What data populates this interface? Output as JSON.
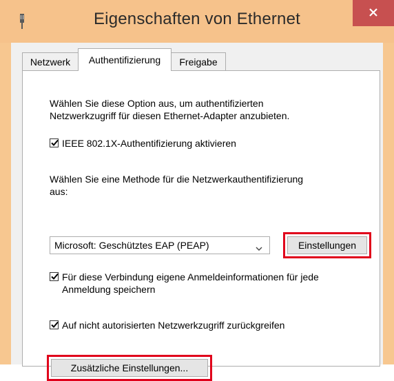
{
  "window": {
    "title": "Eigenschaften von Ethernet",
    "close_label": "×",
    "colors": {
      "frame": "#f6c28b",
      "close": "#c75050",
      "highlight": "#e0001b"
    }
  },
  "tabs": [
    {
      "label": "Netzwerk",
      "active": false
    },
    {
      "label": "Authentifizierung",
      "active": true
    },
    {
      "label": "Freigabe",
      "active": false
    }
  ],
  "panel": {
    "intro_line1": "Wählen Sie diese Option aus, um authentifizierten",
    "intro_line2": "Netzwerkzugriff für diesen Ethernet-Adapter anzubieten.",
    "enable_8021x": {
      "label": "IEEE 802.1X-Authentifizierung aktivieren",
      "checked": true
    },
    "method_line1": "Wählen Sie eine Methode für die Netzwerkauthentifizierung",
    "method_line2": "aus:",
    "method_select": {
      "value": "Microsoft: Geschütztes EAP (PEAP)"
    },
    "settings_button": "Einstellungen",
    "remember_credentials": {
      "label_line1": "Für diese Verbindung eigene Anmeldeinformationen für jede",
      "label_line2": "Anmeldung speichern",
      "checked": true
    },
    "fallback_unauthorized": {
      "label": "Auf nicht autorisierten Netzwerkzugriff zurückgreifen",
      "checked": true
    },
    "additional_settings_button": "Zusätzliche Einstellungen..."
  }
}
